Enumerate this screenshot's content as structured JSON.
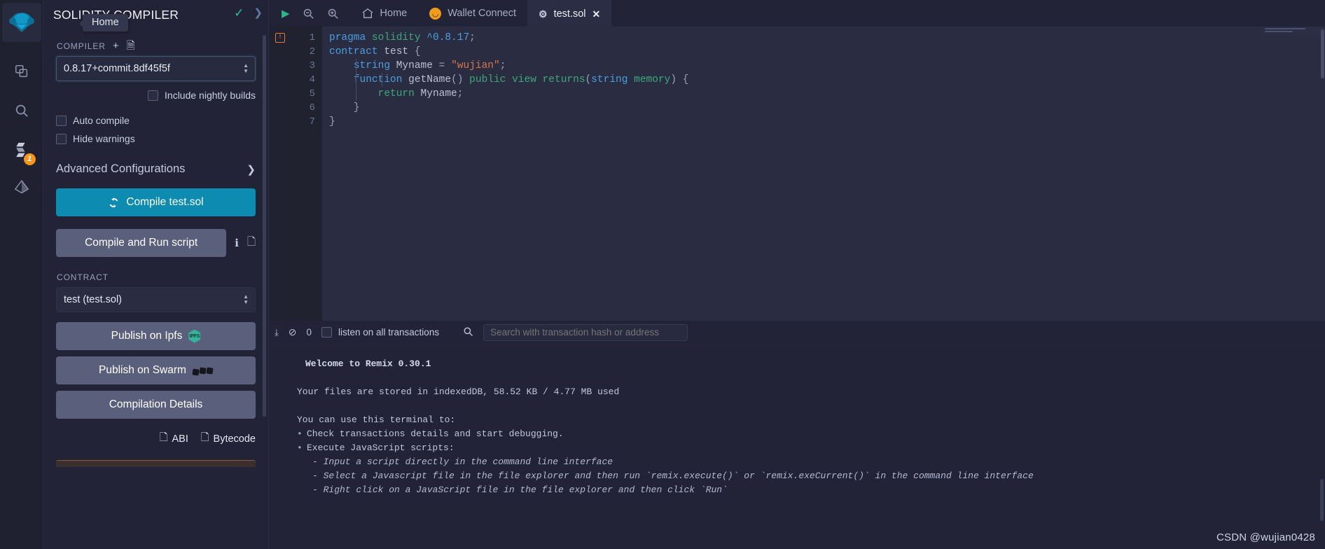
{
  "iconbar": {
    "logo_name": "remix-logo-icon",
    "items": [
      {
        "name": "file-explorer-icon",
        "glyph": "⧉"
      },
      {
        "name": "search-icon",
        "glyph": "⚲"
      },
      {
        "name": "solidity-compiler-icon",
        "glyph": "↻",
        "badge": "1"
      },
      {
        "name": "deploy-run-icon",
        "glyph": "⬧"
      }
    ]
  },
  "panel": {
    "title": "SOLIDITY COMPILER",
    "tooltip": "Home",
    "check_icon": "check-icon",
    "chevron_icon": "chevron-right-icon",
    "compiler_label": "COMPILER",
    "add_icon": "plus-icon",
    "file_icon": "file-icon",
    "compiler_version": "0.8.17+commit.8df45f5f",
    "include_nightly": "Include nightly builds",
    "auto_compile": "Auto compile",
    "hide_warnings": "Hide warnings",
    "advanced": "Advanced Configurations",
    "compile_btn": "Compile test.sol",
    "compile_icon": "refresh-icon",
    "compile_run_btn": "Compile and Run script",
    "info_icon": "info-icon",
    "copy_icon": "copy-icon",
    "contract_label": "CONTRACT",
    "contract_value": "test (test.sol)",
    "publish_ipfs": "Publish on Ipfs",
    "ipfs_badge": "IPFS",
    "publish_swarm": "Publish on Swarm",
    "compilation_details": "Compilation Details",
    "copy_abi": "ABI",
    "copy_bytecode": "Bytecode"
  },
  "topbar": {
    "run_icon": "play-icon",
    "zoom_out_icon": "zoom-out-icon",
    "zoom_in_icon": "zoom-in-icon",
    "home_icon": "home-icon",
    "home_label": "Home",
    "wallet_icon": "walletconnect-icon",
    "wallet_label": "Wallet Connect",
    "file_tab_icon": "solidity-file-icon",
    "file_tab_label": "test.sol",
    "close_icon": "close-icon"
  },
  "editor": {
    "error_marker": "!",
    "line_numbers": [
      "1",
      "2",
      "3",
      "4",
      "5",
      "6",
      "7"
    ],
    "lines": [
      [
        {
          "t": "pragma",
          "c": "cd-kw"
        },
        {
          "t": " ",
          "c": "cd-pun"
        },
        {
          "t": "solidity",
          "c": "cd-kw2"
        },
        {
          "t": " ",
          "c": "cd-pun"
        },
        {
          "t": "^0.8.17",
          "c": "cd-num"
        },
        {
          "t": ";",
          "c": "cd-pun"
        }
      ],
      [
        {
          "t": "contract",
          "c": "cd-kw"
        },
        {
          "t": " ",
          "c": "cd-pun"
        },
        {
          "t": "test",
          "c": "cd-id"
        },
        {
          "t": " {",
          "c": "cd-pun"
        }
      ],
      [
        {
          "t": "    ",
          "c": "cd-pun"
        },
        {
          "t": "string",
          "c": "cd-kw"
        },
        {
          "t": " ",
          "c": "cd-pun"
        },
        {
          "t": "Myname",
          "c": "cd-id"
        },
        {
          "t": " = ",
          "c": "cd-pun"
        },
        {
          "t": "\"wujian\"",
          "c": "cd-str"
        },
        {
          "t": ";",
          "c": "cd-pun"
        }
      ],
      [
        {
          "t": "    ",
          "c": "cd-pun"
        },
        {
          "t": "function",
          "c": "cd-kw"
        },
        {
          "t": " ",
          "c": "cd-pun"
        },
        {
          "t": "getName",
          "c": "cd-id"
        },
        {
          "t": "() ",
          "c": "cd-pun"
        },
        {
          "t": "public",
          "c": "cd-kw2"
        },
        {
          "t": " ",
          "c": "cd-pun"
        },
        {
          "t": "view",
          "c": "cd-kw2"
        },
        {
          "t": " ",
          "c": "cd-pun"
        },
        {
          "t": "returns",
          "c": "cd-kw2"
        },
        {
          "t": "(",
          "c": "cd-pun"
        },
        {
          "t": "string",
          "c": "cd-kw"
        },
        {
          "t": " ",
          "c": "cd-pun"
        },
        {
          "t": "memory",
          "c": "cd-kw2"
        },
        {
          "t": ") {",
          "c": "cd-pun"
        }
      ],
      [
        {
          "t": "        ",
          "c": "cd-pun"
        },
        {
          "t": "return",
          "c": "cd-kw2"
        },
        {
          "t": " ",
          "c": "cd-pun"
        },
        {
          "t": "Myname",
          "c": "cd-id"
        },
        {
          "t": ";",
          "c": "cd-pun"
        }
      ],
      [
        {
          "t": "    }",
          "c": "cd-pun"
        }
      ],
      [
        {
          "t": "}",
          "c": "cd-pun"
        }
      ]
    ]
  },
  "terminal": {
    "toggle_icon": "chevron-double-down-icon",
    "clear_icon": "no-entry-icon",
    "pending_count": "0",
    "listen_label": "listen on all transactions",
    "search_icon": "search-icon",
    "search_placeholder": "Search with transaction hash or address",
    "welcome": "Welcome to Remix 0.30.1",
    "storage": "Your files are stored in indexedDB, 58.52 KB / 4.77 MB used",
    "intro": "You can use this terminal to:",
    "bullets": [
      "Check transactions details and start debugging.",
      "Execute JavaScript scripts:"
    ],
    "sub_bullets": [
      "- Input a script directly in the command line interface",
      "- Select a Javascript file in the file explorer and then run `remix.execute()` or `remix.exeCurrent()` in the command line interface",
      "- Right click on a JavaScript file in the file explorer and then click `Run`"
    ]
  },
  "watermark": "CSDN @wujian0428"
}
